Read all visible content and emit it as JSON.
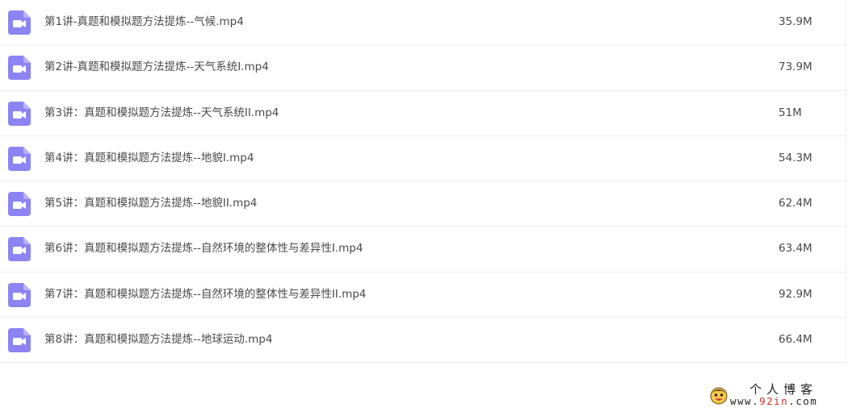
{
  "files": [
    {
      "name": "第1讲-真题和模拟题方法提炼--气候.mp4",
      "size": "35.9M",
      "icon": "video-file-icon"
    },
    {
      "name": "第2讲-真题和模拟题方法提炼--天气系统I.mp4",
      "size": "73.9M",
      "icon": "video-file-icon"
    },
    {
      "name": "第3讲：真题和模拟题方法提炼--天气系统II.mp4",
      "size": "51M",
      "icon": "video-file-icon"
    },
    {
      "name": "第4讲：真题和模拟题方法提炼--地貌I.mp4",
      "size": "54.3M",
      "icon": "video-file-icon"
    },
    {
      "name": "第5讲：真题和模拟题方法提炼--地貌II.mp4",
      "size": "62.4M",
      "icon": "video-file-icon"
    },
    {
      "name": "第6讲：真题和模拟题方法提炼--自然环境的整体性与差异性I.mp4",
      "size": "63.4M",
      "icon": "video-file-icon"
    },
    {
      "name": "第7讲：真题和模拟题方法提炼--自然环境的整体性与差异性II.mp4",
      "size": "92.9M",
      "icon": "video-file-icon"
    },
    {
      "name": "第8讲：真题和模拟题方法提炼--地球运动.mp4",
      "size": "66.4M",
      "icon": "video-file-icon"
    }
  ],
  "watermark": {
    "title": "个人博客",
    "url_prefix": "www.",
    "url_highlight": "92in",
    "url_suffix": ".com"
  },
  "colors": {
    "icon_purple": "#8c84f2",
    "text": "#4a4a4a",
    "divider": "#ececec"
  }
}
